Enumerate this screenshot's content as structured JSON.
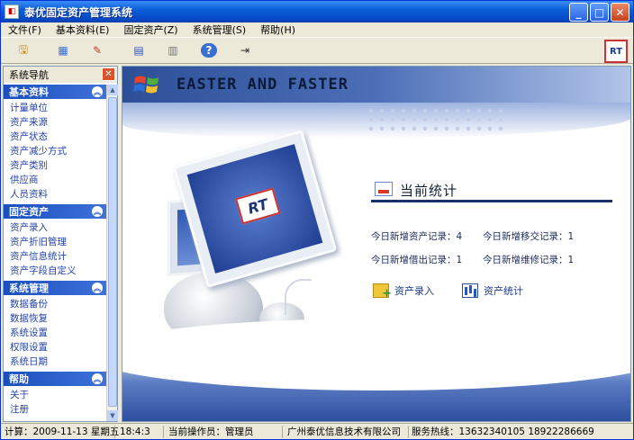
{
  "window": {
    "title": "泰优固定资产管理系统",
    "icon": "app-window-icon",
    "controls": [
      "minimize-icon",
      "maximize-icon",
      "close-icon"
    ]
  },
  "menubar": [
    "文件(F)",
    "基本资料(E)",
    "固定资产(Z)",
    "系统管理(S)",
    "帮助(H)"
  ],
  "toolbar": {
    "buttons": [
      {
        "name": "document-save-icon",
        "glyph": "🖫"
      },
      {
        "name": "chart-icon",
        "glyph": "▦"
      },
      {
        "name": "pen-icon",
        "glyph": "✎"
      },
      {
        "name": "calculator-icon",
        "glyph": "▤"
      },
      {
        "name": "clipboard-icon",
        "glyph": "▥"
      },
      {
        "name": "help-icon",
        "glyph": "?"
      },
      {
        "name": "exit-icon",
        "glyph": "⇥"
      }
    ],
    "logo": "RT"
  },
  "sidebar": {
    "header": "系统导航",
    "groups": [
      {
        "title": "基本资料",
        "items": [
          "计量单位",
          "资产来源",
          "资产状态",
          "资产减少方式",
          "资产类别",
          "供应商",
          "人员资料"
        ]
      },
      {
        "title": "固定资产",
        "items": [
          "资产录入",
          "资产折旧管理",
          "资产信息统计",
          "资产字段自定义"
        ]
      },
      {
        "title": "系统管理",
        "items": [
          "数据备份",
          "数据恢复",
          "系统设置",
          "权限设置",
          "系统日期"
        ]
      },
      {
        "title": "帮助",
        "items": [
          "关于",
          "注册"
        ]
      }
    ]
  },
  "main": {
    "banner": "EASTER AND FASTER",
    "screen_logo": "RT",
    "stats_title": "当前统计",
    "stats": {
      "new_assets": "今日新增资产记录：4",
      "new_transfers": "今日新增移交记录：1",
      "new_loans": "今日新增借出记录：1",
      "new_repairs": "今日新增维修记录：1"
    },
    "actions": {
      "asset_entry": "资产录入",
      "asset_stats": "资产统计"
    }
  },
  "statusbar": {
    "date": "计算：2009-11-13 星期五",
    "time": "18:4:3",
    "operator": "当前操作员：管理员",
    "company": "广州泰优信息技术有限公司",
    "service": "服务热线：13632340105 18922286669"
  },
  "colors": {
    "title_bar": "#0a5fd8",
    "sidebar_group": "#1a4fbf",
    "link_text": "#2443a8",
    "close_red": "#c7401c"
  }
}
